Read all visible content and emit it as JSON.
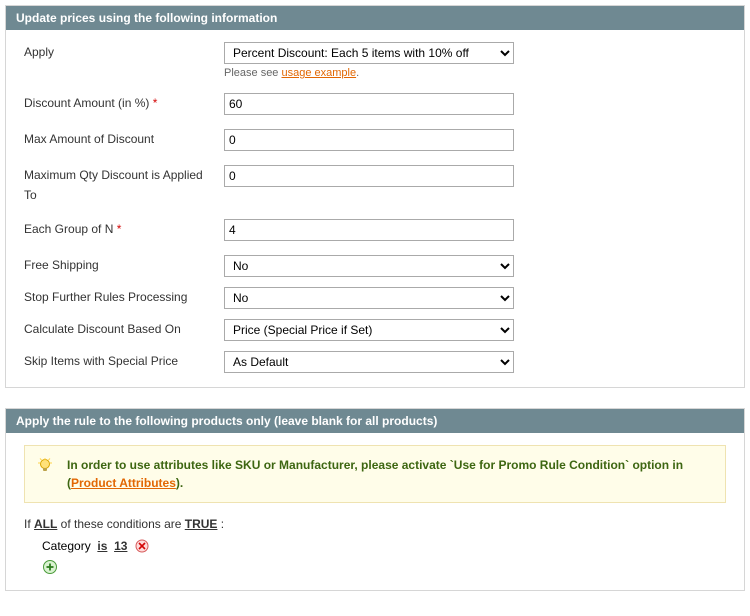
{
  "panel1": {
    "title": "Update prices using the following information",
    "apply_label": "Apply",
    "apply_value": "Percent Discount: Each 5 items with 10% off",
    "apply_helper_prefix": "Please see ",
    "apply_helper_link": "usage example",
    "apply_helper_suffix": ".",
    "discount_amount_label": "Discount Amount (in %)",
    "discount_amount_value": "60",
    "max_amount_label": "Max Amount of Discount",
    "max_amount_value": "0",
    "max_qty_label": "Maximum Qty Discount is Applied To",
    "max_qty_value": "0",
    "group_n_label": "Each Group of N",
    "group_n_value": "4",
    "free_shipping_label": "Free Shipping",
    "free_shipping_value": "No",
    "stop_rules_label": "Stop Further Rules Processing",
    "stop_rules_value": "No",
    "calc_based_label": "Calculate Discount Based On",
    "calc_based_value": "Price (Special Price if Set)",
    "skip_special_label": "Skip Items with Special Price",
    "skip_special_value": "As Default"
  },
  "panel2": {
    "title": "Apply the rule to the following products only (leave blank for all products)",
    "notice_prefix": "In order to use attributes like SKU or Manufacturer, please activate `Use for Promo Rule Condition` option in (",
    "notice_link": "Product Attributes",
    "notice_suffix": ").",
    "cond_prefix": "If ",
    "cond_agg": "ALL",
    "cond_mid": "  of these conditions are ",
    "cond_val": "TRUE",
    "cond_end": " :",
    "rule_attr": "Category",
    "rule_op": "is",
    "rule_value": "13"
  }
}
